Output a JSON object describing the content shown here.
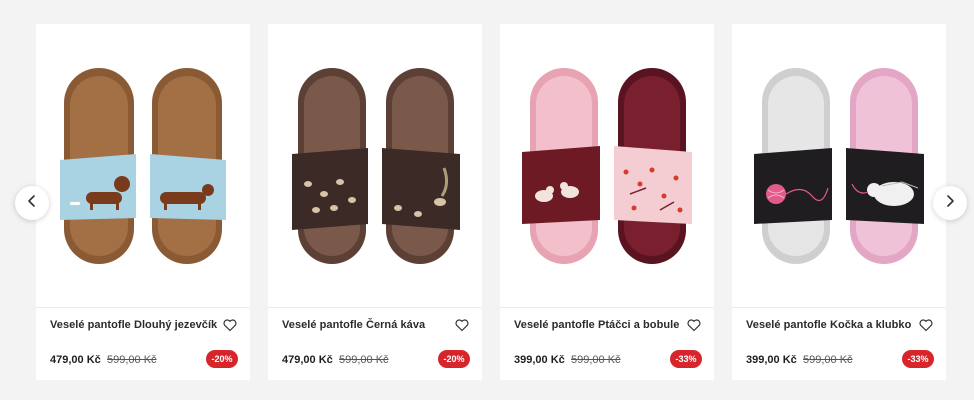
{
  "carousel": {
    "prev_icon": "chevron-left-icon",
    "next_icon": "chevron-right-icon",
    "products": [
      {
        "name": "Veselé pantofle Dlouhý jezevčík",
        "price": "479,00 Kč",
        "old_price": "599,00 Kč",
        "discount": "-20%",
        "strap_color": "#a9d3e3",
        "sole_color": "#8a5a35"
      },
      {
        "name": "Veselé pantofle Černá káva",
        "price": "479,00 Kč",
        "old_price": "599,00 Kč",
        "discount": "-20%",
        "strap_color": "#3b2a26",
        "sole_color": "#6a4a3e"
      },
      {
        "name": "Veselé pantofle Ptáčci a bobule",
        "price": "399,00 Kč",
        "old_price": "599,00 Kč",
        "discount": "-33%",
        "strap_color": "#6e1a24",
        "sole_color": "#f0b5c2"
      },
      {
        "name": "Veselé pantofle Kočka a klubko",
        "price": "399,00 Kč",
        "old_price": "599,00 Kč",
        "discount": "-33%",
        "strap_color": "#1f1d20",
        "sole_color": "#e0e0e0"
      }
    ]
  },
  "colors": {
    "badge": "#d6262c",
    "background": "#f3f3f3",
    "card": "#ffffff"
  }
}
